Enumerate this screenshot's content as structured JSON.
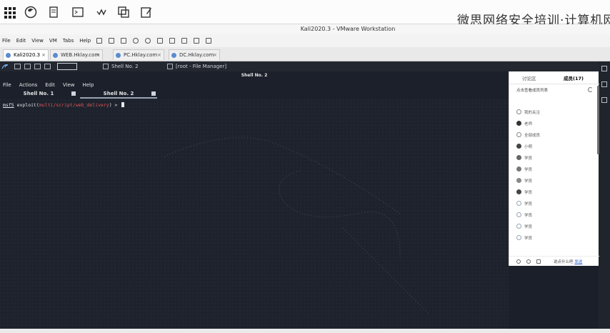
{
  "host": {
    "watermark": "微思网络安全培训·计算机网络",
    "dock_icons": [
      "apps-grid-icon",
      "firefox-icon",
      "notes-app-icon",
      "terminal-app-icon",
      "vmware-icon",
      "text-editor-icon"
    ]
  },
  "vmware": {
    "title": "Kali2020.3 - VMware Workstation",
    "menu": [
      "File",
      "Edit",
      "View",
      "VM",
      "Tabs",
      "Help"
    ],
    "tabs": [
      {
        "label": "Kali2020.3",
        "active": true
      },
      {
        "label": "WEB.Hklay.com",
        "active": false
      },
      {
        "label": "PC.Hklay.com",
        "active": false
      },
      {
        "label": "DC.Hklay.com",
        "active": false
      }
    ]
  },
  "kali": {
    "tasks": [
      {
        "label": "Shell No. 2"
      },
      {
        "label": "[root - File Manager]"
      }
    ]
  },
  "terminal": {
    "title": "Shell No. 2",
    "menu": [
      "File",
      "Actions",
      "Edit",
      "View",
      "Help"
    ],
    "tabs": [
      {
        "label": "Shell No. 1",
        "active": false
      },
      {
        "label": "Shell No. 2",
        "active": true
      }
    ],
    "prompt": {
      "msf": "msf5",
      "exploit_prefix": " exploit(",
      "module": "multi/script/web_delivery",
      "suffix": ") > "
    }
  },
  "chat": {
    "tab_discuss": "讨论区",
    "tab_members": "成员(17)",
    "subtitle": "点击查看成员列表",
    "rows": [
      {
        "label": "  我的关注",
        "color": "#ffffff"
      },
      {
        "label": "  老师",
        "color": "#333333"
      },
      {
        "label": "  全部成员",
        "color": "#ffffff"
      },
      {
        "label": "  小明",
        "color": "#444444"
      },
      {
        "label": "  学员",
        "color": "#666666"
      },
      {
        "label": "  学员",
        "color": "#777777"
      },
      {
        "label": "  学员",
        "color": "#888888"
      },
      {
        "label": "  学员",
        "color": "#444444"
      },
      {
        "label": "  学员",
        "color": "#9aa3b3"
      },
      {
        "label": "  学员",
        "color": "#9aa3b3"
      },
      {
        "label": "  学员",
        "color": "#9aa3b3"
      },
      {
        "label": "  学员",
        "color": "#9aa3b3"
      }
    ],
    "footer_text": "说点什么吧",
    "footer_link": "发送"
  }
}
